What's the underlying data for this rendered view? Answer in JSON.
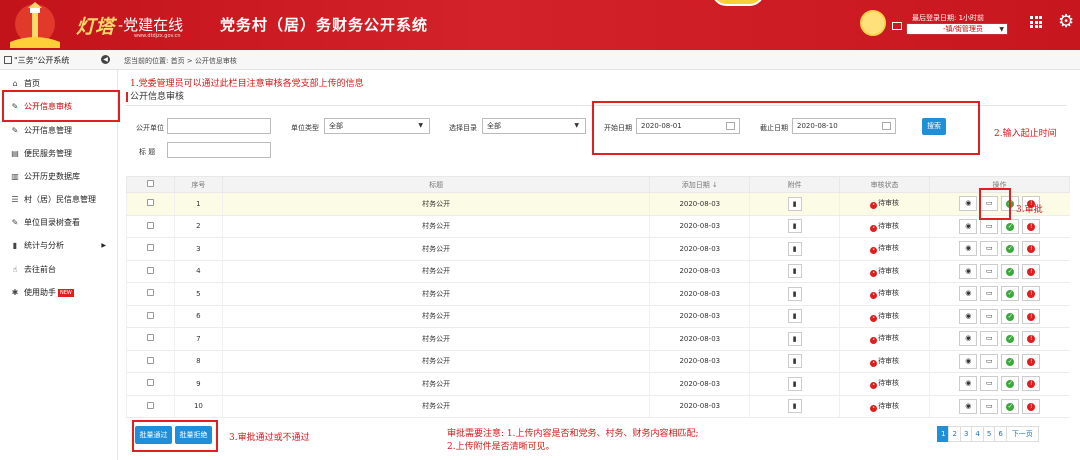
{
  "header": {
    "logo_main": "灯塔",
    "logo_sub": "-党建在线",
    "logo_url": "www.dtdjzx.gov.cn",
    "title": "党务村（居）务财务公开系统",
    "last_login_label": "最后登录日期: 1小时前",
    "user_role": "-镇/街管理员",
    "brand_red": "#c8161e"
  },
  "subbar": {
    "system_name": "\"三务\"公开系统",
    "breadcrumb": "您当前的位置:  首页  >  公开信息审核"
  },
  "sidebar": {
    "items": [
      {
        "icon": "home-icon",
        "label": "首页"
      },
      {
        "icon": "edit-icon",
        "label": "公开信息审核"
      },
      {
        "icon": "edit-icon",
        "label": "公开信息管理"
      },
      {
        "icon": "document-icon",
        "label": "便民服务管理"
      },
      {
        "icon": "trash-icon",
        "label": "公开历史数据库"
      },
      {
        "icon": "list-icon",
        "label": "村（居）民信息管理"
      },
      {
        "icon": "edit-icon",
        "label": "单位目录树查看"
      },
      {
        "icon": "bar-chart-icon",
        "label": "统计与分析"
      },
      {
        "icon": "pointer-icon",
        "label": "去往前台"
      },
      {
        "icon": "help-icon",
        "label": "使用助手",
        "badge": "NEW"
      }
    ]
  },
  "annotations": {
    "a1": "1.党委管理员可以通过此栏目注意审核各党支部上传的信息",
    "a2": "2.输入起止时间",
    "a3": "3.审批",
    "a4": "3.审批通过或不通过",
    "a5_line1": "审批需要注意: 1.上传内容是否和党务、村务、财务内容相匹配;",
    "a5_line2": "2.上传附件是否清晰可见。"
  },
  "panel": {
    "title": "公开信息审核"
  },
  "filters": {
    "unit_label": "公开单位",
    "unit_value": "",
    "type_label": "单位类型",
    "type_value": "全部",
    "catalog_label": "选择目录",
    "catalog_value": "全部",
    "start_label": "开始日期",
    "start_value": "2020-08-01",
    "end_label": "截止日期",
    "end_value": "2020-08-10",
    "search_label": "搜索",
    "title_label": "标    题",
    "title_value": ""
  },
  "table": {
    "headers": {
      "seq": "序号",
      "title": "标题",
      "date": "添加日期 ↓",
      "attachment": "附件",
      "status": "审核状态",
      "ops": "操作"
    },
    "rows": [
      {
        "seq": "1",
        "title": "村务公开",
        "date": "2020-08-03",
        "status": "待审核"
      },
      {
        "seq": "2",
        "title": "村务公开",
        "date": "2020-08-03",
        "status": "待审核"
      },
      {
        "seq": "3",
        "title": "村务公开",
        "date": "2020-08-03",
        "status": "待审核"
      },
      {
        "seq": "4",
        "title": "村务公开",
        "date": "2020-08-03",
        "status": "待审核"
      },
      {
        "seq": "5",
        "title": "村务公开",
        "date": "2020-08-03",
        "status": "待审核"
      },
      {
        "seq": "6",
        "title": "村务公开",
        "date": "2020-08-03",
        "status": "待审核"
      },
      {
        "seq": "7",
        "title": "村务公开",
        "date": "2020-08-03",
        "status": "待审核"
      },
      {
        "seq": "8",
        "title": "村务公开",
        "date": "2020-08-03",
        "status": "待审核"
      },
      {
        "seq": "9",
        "title": "村务公开",
        "date": "2020-08-03",
        "status": "待审核"
      },
      {
        "seq": "10",
        "title": "村务公开",
        "date": "2020-08-03",
        "status": "待审核"
      }
    ]
  },
  "batch": {
    "approve_label": "批量通过",
    "reject_label": "批量拒绝"
  },
  "pager": {
    "pages": [
      "1",
      "2",
      "3",
      "4",
      "5",
      "6"
    ],
    "next_label": "下一页"
  }
}
